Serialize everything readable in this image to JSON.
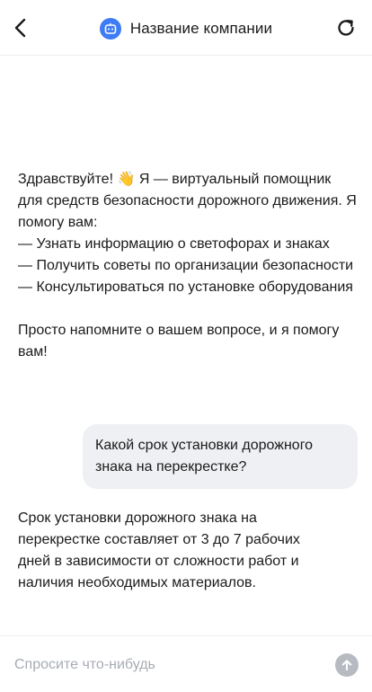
{
  "header": {
    "title": "Название компании",
    "back_icon": "chevron-left-icon",
    "avatar_icon": "bot-icon",
    "refresh_icon": "refresh-icon",
    "accent_color": "#3d7cf5"
  },
  "messages": [
    {
      "role": "bot",
      "text": "Здравствуйте! 👋 Я — виртуальный помощник для средств безопасности дорожного движения. Я помогу вам:\n— Узнать информацию о светофорах и знаках\n— Получить советы по организации безопасности\n— Консультироваться по установке оборудования\n\nПросто напомните о вашем вопросе, и я помогу вам!"
    },
    {
      "role": "user",
      "text": "Какой срок установки дорожного знака на перекрестке?"
    },
    {
      "role": "bot",
      "text": "Срок установки дорожного знака на перекрестке составляет от 3 до 7 рабочих дней в зависимости от сложности работ и наличия необходимых материалов."
    }
  ],
  "composer": {
    "placeholder": "Спросите что-нибудь",
    "value": "",
    "send_icon": "arrow-up-icon"
  }
}
